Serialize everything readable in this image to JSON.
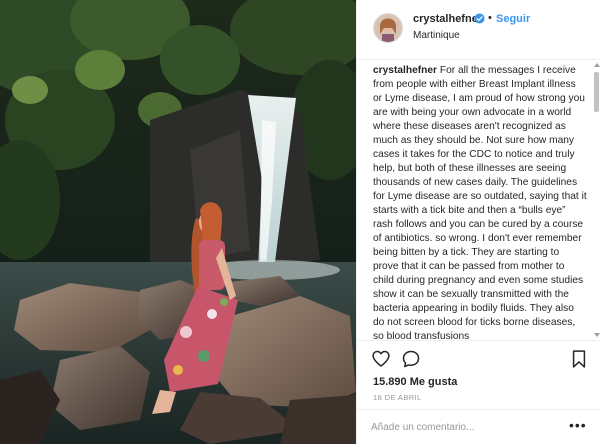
{
  "header": {
    "username": "crystalhefner",
    "separator": "•",
    "follow_label": "Seguir",
    "location": "Martinique"
  },
  "caption": {
    "username": "crystalhefner",
    "text": "For all the messages I receive from people with either Breast Implant illness or Lyme disease, I am proud of how strong you are with being your own advocate in a world where these diseases aren't recognized as much as they should be. Not sure how many cases it takes for the CDC to notice and truly help, but both of these illnesses are seeing thousands of new cases daily. The guidelines for Lyme disease are so outdated, saying that it starts with a tick bite and then a “bulls eye” rash follows and you can be cured by a course of antibiotics. so wrong. I don't ever remember being bitten by a tick. They are starting to prove that it can be passed from mother to child during pregnancy and even some studies show it can be sexually transmitted with the bacteria appearing in bodily fluids. They also do not screen blood for ticks borne diseases, so blood transfusions"
  },
  "stats": {
    "likes": "15.890 Me gusta",
    "date": "18 DE ABRIL"
  },
  "comment": {
    "placeholder": "Añade un comentario...",
    "more_label": "•••"
  },
  "colors": {
    "accent": "#3897f0",
    "text": "#262626",
    "muted": "#999999",
    "border": "#efefef"
  },
  "icons": {
    "like": "heart-outline-icon",
    "comment": "comment-bubble-icon",
    "save": "bookmark-icon",
    "verified": "verified-badge-icon"
  }
}
